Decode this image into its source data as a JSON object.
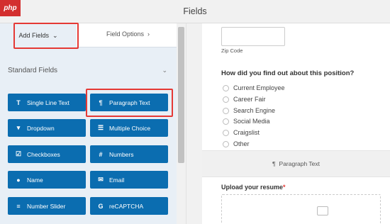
{
  "watermark": "php",
  "app": {
    "title": "Fields"
  },
  "tabs": {
    "add_fields": "Add Fields",
    "field_options": "Field Options"
  },
  "section": {
    "title": "Standard Fields"
  },
  "fields": {
    "single_line_text": "Single Line Text",
    "paragraph_text": "Paragraph Text",
    "dropdown": "Dropdown",
    "multiple_choice": "Multiple Choice",
    "checkboxes": "Checkboxes",
    "numbers": "Numbers",
    "name": "Name",
    "email": "Email",
    "number_slider": "Number Slider",
    "recaptcha": "reCAPTCHA"
  },
  "icons": {
    "single_line_text": "T",
    "paragraph_text": "¶",
    "dropdown": "▾",
    "multiple_choice": "☰",
    "checkboxes": "☑",
    "numbers": "#",
    "name": "●",
    "email": "✉",
    "number_slider": "≡",
    "recaptcha": "G"
  },
  "preview": {
    "zip_label": "Zip Code",
    "question": "How did you find out about this position?",
    "options": [
      "Current Employee",
      "Career Fair",
      "Search Engine",
      "Social Media",
      "Craigslist",
      "Other"
    ],
    "paragraph_field_label": "Paragraph Text",
    "upload_label": "Upload your resume",
    "required_mark": "*"
  },
  "colors": {
    "button_blue": "#0b6db0",
    "highlight_red": "#e53935"
  }
}
